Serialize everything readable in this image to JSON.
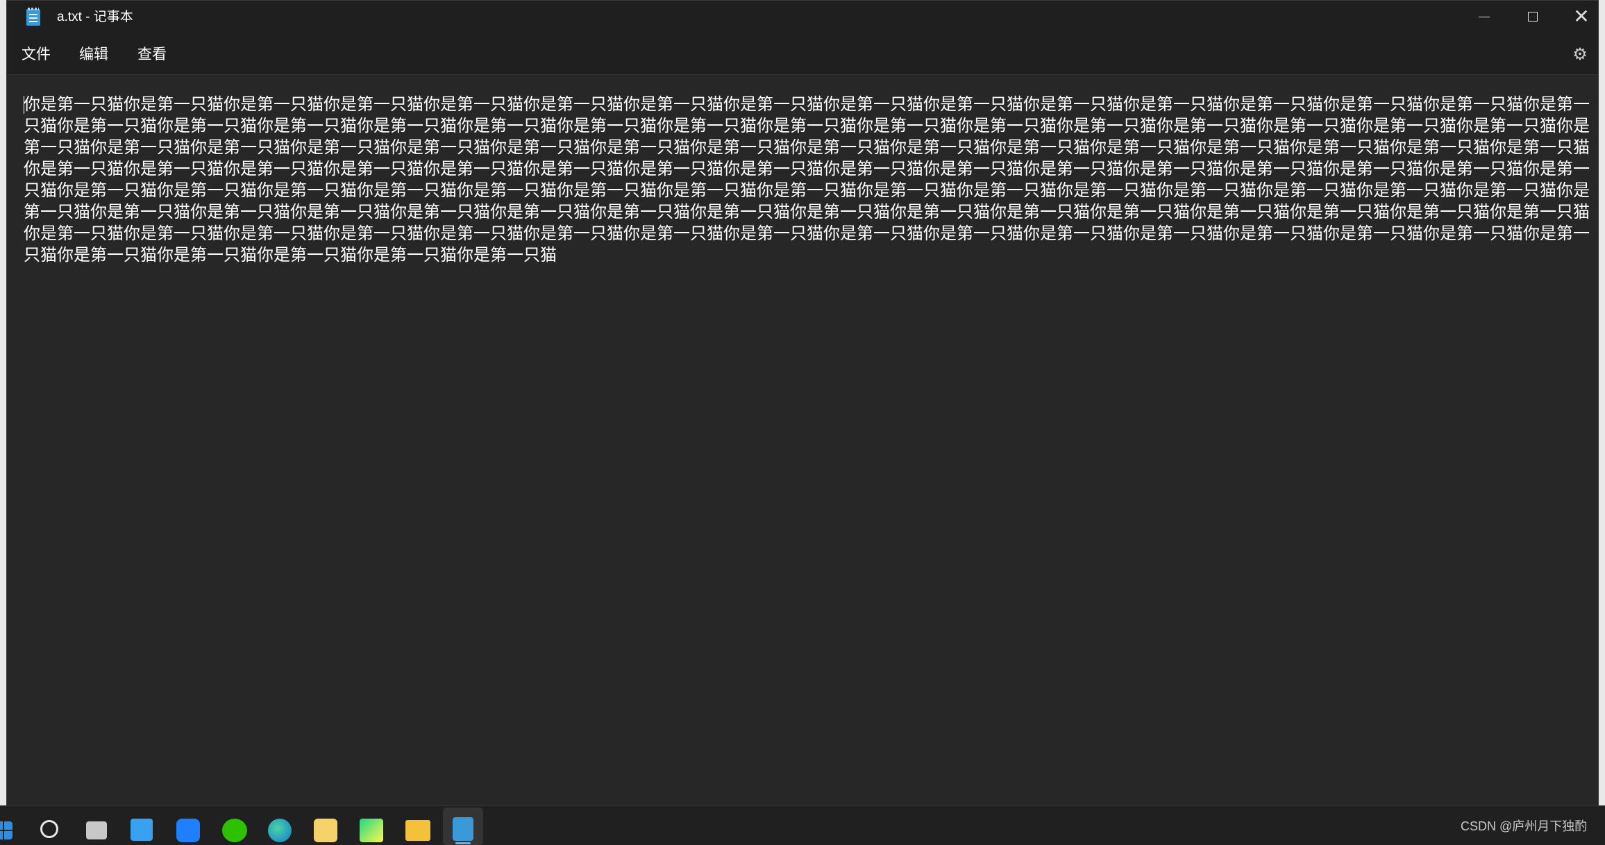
{
  "window": {
    "title": "a.txt - 记事本"
  },
  "controls": {
    "minimize_icon": "minimize-icon",
    "maximize_icon": "maximize-icon",
    "close_icon": "close-icon",
    "minimize": "—",
    "close": "✕"
  },
  "menu": {
    "file": "文件",
    "edit": "编辑",
    "view": "查看",
    "settings_icon": "gear-icon",
    "settings_glyph": "⚙"
  },
  "editor": {
    "content": "你是第一只猫你是第一只猫你是第一只猫你是第一只猫你是第一只猫你是第一只猫你是第一只猫你是第一只猫你是第一只猫你是第一只猫你是第一只猫你是第一只猫你是第一只猫你是第一只猫你是第一只猫你是第一只猫你是第一只猫你是第一只猫你是第一只猫你是第一只猫你是第一只猫你是第一只猫你是第一只猫你是第一只猫你是第一只猫你是第一只猫你是第一只猫你是第一只猫你是第一只猫你是第一只猫你是第一只猫你是第一只猫你是第一只猫你是第一只猫你是第一只猫你是第一只猫你是第一只猫你是第一只猫你是第一只猫你是第一只猫你是第一只猫你是第一只猫你是第一只猫你是第一只猫你是第一只猫你是第一只猫你是第一只猫你是第一只猫你是第一只猫你是第一只猫你是第一只猫你是第一只猫你是第一只猫你是第一只猫你是第一只猫你是第一只猫你是第一只猫你是第一只猫你是第一只猫你是第一只猫你是第一只猫你是第一只猫你是第一只猫你是第一只猫你是第一只猫你是第一只猫你是第一只猫你是第一只猫你是第一只猫你是第一只猫你是第一只猫你是第一只猫你是第一只猫你是第一只猫你是第一只猫你是第一只猫你是第一只猫你是第一只猫你是第一只猫你是第一只猫你是第一只猫你是第一只猫你是第一只猫你是第一只猫你是第一只猫你是第一只猫你是第一只猫你是第一只猫你是第一只猫你是第一只猫你是第一只猫你是第一只猫你是第一只猫你是第一只猫你是第一只猫你是第一只猫你是第一只猫你是第一只猫你是第一只猫你是第一只猫你是第一只猫你是第一只猫你是第一只猫你是第一只猫你是第一只猫你是第一只猫你是第一只猫你是第一只猫你是第一只猫你是第一只猫你是第一只猫你是第一只猫你是第一只猫你是第一只猫你是第一只猫"
  },
  "taskbar": {
    "icons": [
      "windows-start-icon",
      "search-icon",
      "task-view-icon",
      "microsoft-store-icon",
      "feishu-icon",
      "wechat-icon",
      "edge-icon",
      "app-icon",
      "pycharm-icon",
      "file-explorer-icon",
      "notepad-icon"
    ],
    "watermark": "CSDN @庐州月下独酌"
  },
  "colors": {
    "window_bg": "#272727",
    "titlebar_bg": "#1f1f1f",
    "text": "#ffffff",
    "accent": "#5fb2f1"
  }
}
